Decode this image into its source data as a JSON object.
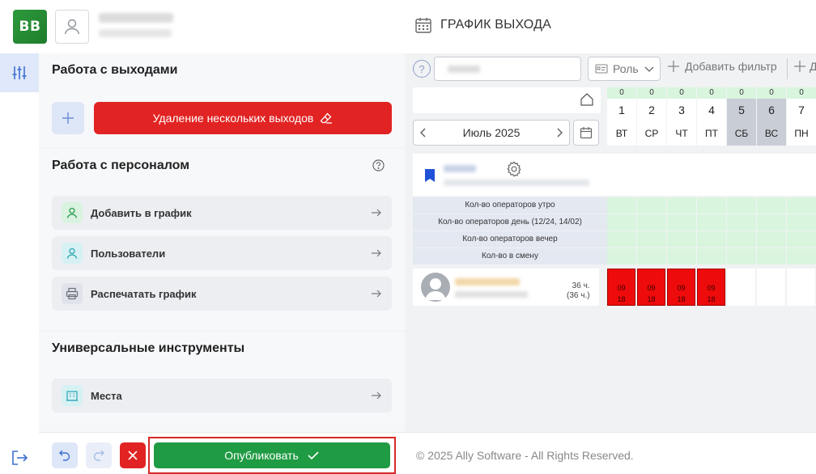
{
  "header": {
    "logo_text": "BB",
    "page_title": "ГРАФИК ВЫХОДА"
  },
  "panel": {
    "section1_title": "Работа с выходами",
    "delete_multiple_label": "Удаление нескольких выходов",
    "section2_title": "Работа с персоналом",
    "items": [
      {
        "label": "Добавить в график"
      },
      {
        "label": "Пользователи"
      },
      {
        "label": "Распечатать график"
      }
    ],
    "section3_title": "Универсальные инструменты",
    "tools": [
      {
        "label": "Места"
      }
    ]
  },
  "bottom": {
    "publish_label": "Опубликовать",
    "copyright": "© 2025 Ally Software - All Rights Reserved."
  },
  "calendar": {
    "help_icon_text": "?",
    "role_label": "Роль",
    "add_filter_label": "Добавить фильтр",
    "add_filter2_label": "Д",
    "month_label": "Июль 2025",
    "days": [
      {
        "count": "0",
        "num": "1",
        "weekday": "ВТ",
        "weekend": false
      },
      {
        "count": "0",
        "num": "2",
        "weekday": "СР",
        "weekend": false
      },
      {
        "count": "0",
        "num": "3",
        "weekday": "ЧТ",
        "weekend": false
      },
      {
        "count": "0",
        "num": "4",
        "weekday": "ПТ",
        "weekend": false
      },
      {
        "count": "0",
        "num": "5",
        "weekday": "СБ",
        "weekend": true
      },
      {
        "count": "0",
        "num": "6",
        "weekday": "ВС",
        "weekend": true
      },
      {
        "count": "0",
        "num": "7",
        "weekday": "ПН",
        "weekend": false
      }
    ],
    "stat_rows": [
      "Кол-во операторов утро",
      "Кол-во операторов день (12/24, 14/02)",
      "Кол-во операторов вечер",
      "Кол-во в смену"
    ],
    "employee": {
      "hours": "36 ч.",
      "hours_sub": "(36 ч.)",
      "shifts": [
        {
          "start": "09",
          "end": "18"
        },
        {
          "start": "09",
          "end": "18"
        },
        {
          "start": "09",
          "end": "18"
        },
        {
          "start": "09",
          "end": "18"
        },
        null,
        null,
        null
      ]
    }
  },
  "colors": {
    "accent_red": "#e22323",
    "publish_green": "#1f9b43",
    "shift_red": "#ee0b0b",
    "count_green": "#d9f5de"
  }
}
